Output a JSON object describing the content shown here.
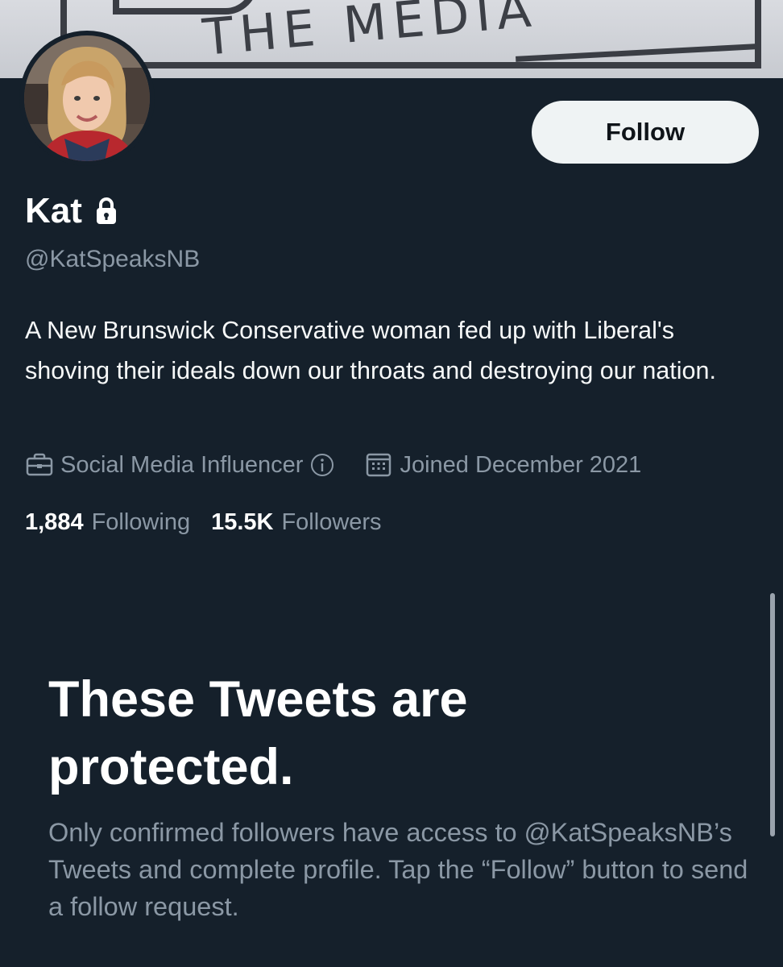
{
  "banner": {
    "text": "THE MEDIA",
    "colors": {
      "background": "#d0d3d8",
      "ink": "#3a3d44"
    }
  },
  "avatar": {
    "icon": "avatar"
  },
  "profile": {
    "name": "Kat",
    "lock_icon": "lock-icon",
    "handle": "@KatSpeaksNB",
    "bio": "A New Brunswick Conservative woman fed up with Liberal's shoving their ideals down our throats and destroying our nation.",
    "category": "Social Media Influencer",
    "category_icon": "briefcase-icon",
    "info_icon": "info-icon",
    "joined": "Joined December 2021",
    "joined_icon": "calendar-icon"
  },
  "stats": {
    "following_count": "1,884",
    "following_label": "Following",
    "followers_count": "15.5K",
    "followers_label": "Followers"
  },
  "actions": {
    "follow_label": "Follow"
  },
  "protected": {
    "title": "These Tweets are protected.",
    "description": "Only confirmed followers have access to @KatSpeaksNB’s Tweets and complete profile. Tap the “Follow” button to send a follow request."
  },
  "colors": {
    "background": "#15202b",
    "primary_text": "#ffffff",
    "secondary_text": "#8b98a5",
    "button_bg": "#eff3f4",
    "button_text": "#0f1419"
  }
}
